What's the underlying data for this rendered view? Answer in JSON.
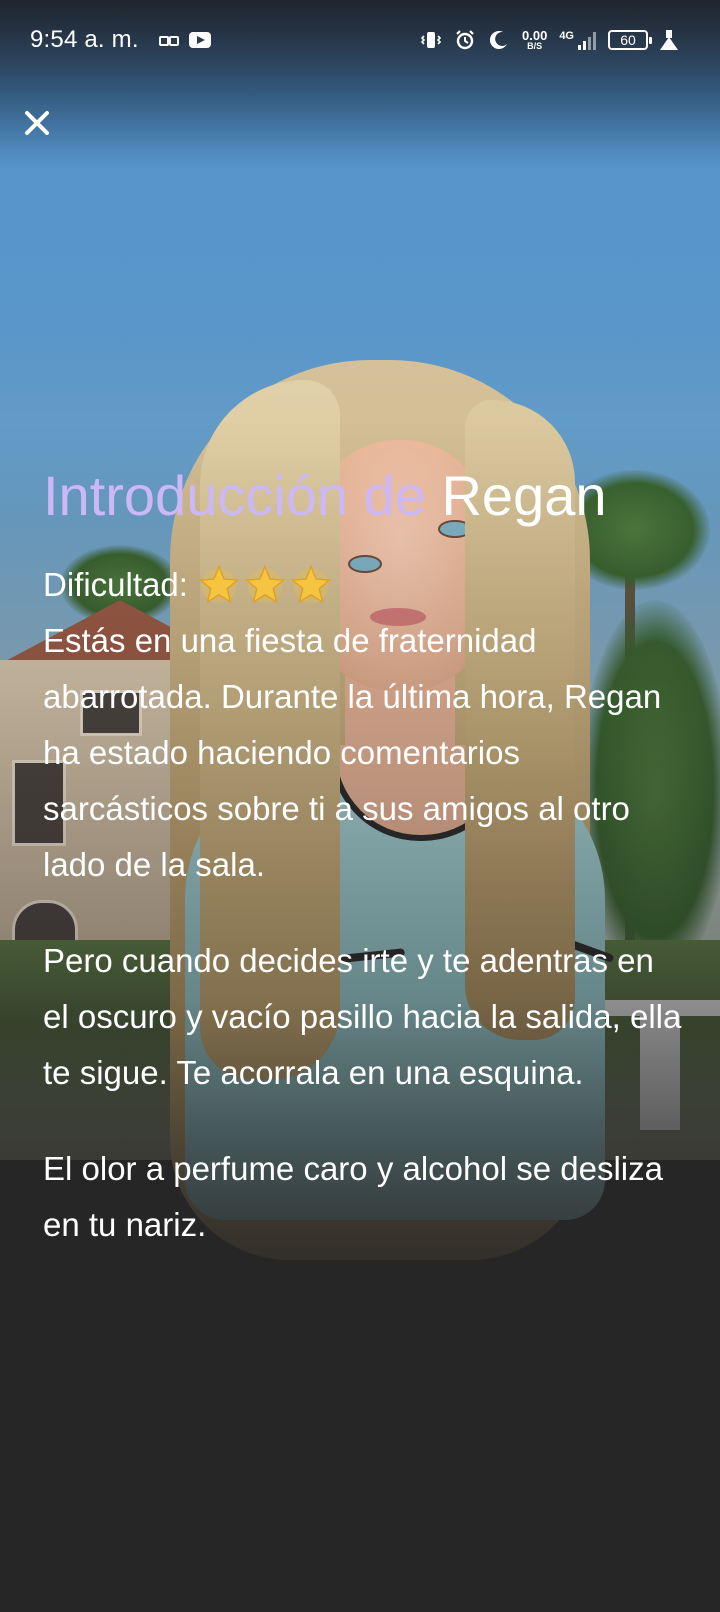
{
  "status_bar": {
    "time": "9:54 a. m.",
    "net_speed_value": "0.00",
    "net_speed_unit": "B/S",
    "network_type": "4G",
    "battery_level": "60",
    "icons": [
      "glasses-icon",
      "youtube-icon",
      "vibrate-icon",
      "alarm-icon",
      "moon-icon",
      "signal-icon",
      "battery-icon",
      "flask-icon"
    ]
  },
  "close_button": {
    "icon": "close-icon"
  },
  "intro": {
    "title_prefix": "Introducción de",
    "character_name": "Regan",
    "difficulty_label": "Dificultad:",
    "difficulty_stars": 3,
    "paragraph_1": "Estás en una fiesta de fraternidad abarrotada. Durante la última hora, Regan ha estado haciendo comentarios sarcásticos sobre ti a sus amigos al otro lado de la sala.",
    "paragraph_2": "Pero cuando decides irte y te adentras en el oscuro y vacío pasillo hacia la salida, ella te sigue. Te acorrala en una esquina.",
    "paragraph_3": "El olor a perfume caro y alcohol se desliza en tu nariz."
  },
  "colors": {
    "title_accent": "#cdb8f7",
    "text": "#ffffff",
    "background": "#262626",
    "star": "#f5c542"
  }
}
